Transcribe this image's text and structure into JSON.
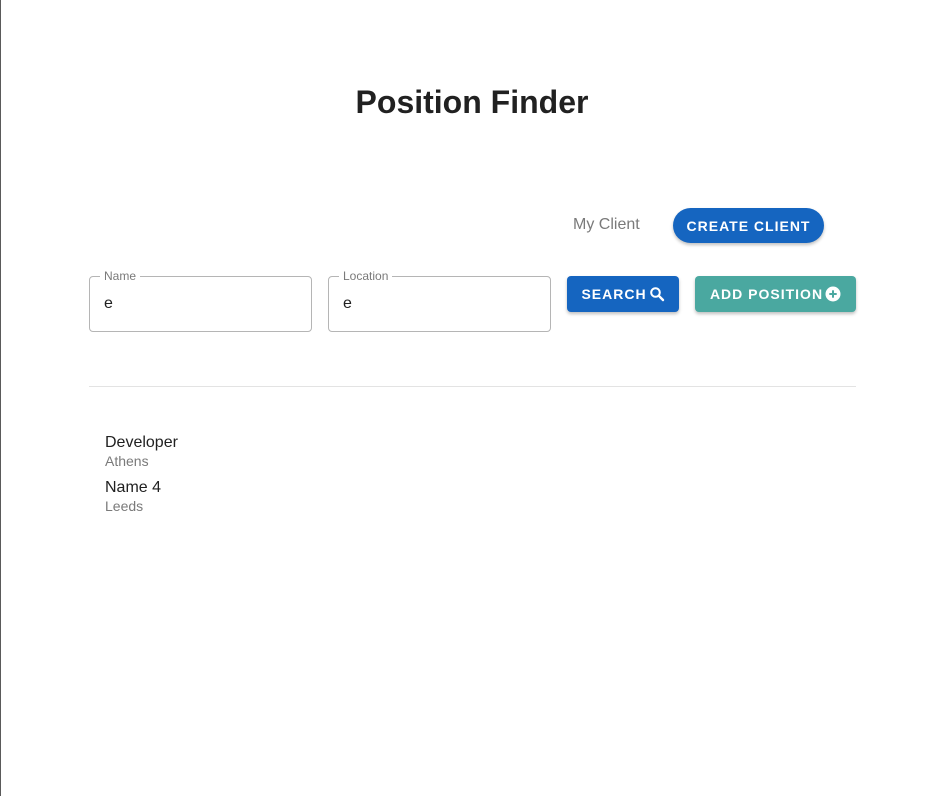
{
  "page": {
    "title": "Position Finder"
  },
  "nav": {
    "my_client_label": "My Client",
    "create_client_label": "CREATE CLIENT"
  },
  "search": {
    "name_label": "Name",
    "name_value": "e",
    "location_label": "Location",
    "location_value": "e",
    "search_label": "SEARCH",
    "search_icon": "search-icon",
    "add_position_label": "ADD POSITION",
    "add_icon": "add-circle-icon"
  },
  "results": [
    {
      "title": "Developer",
      "location": "Athens"
    },
    {
      "title": "Name 4",
      "location": "Leeds"
    }
  ],
  "colors": {
    "primary": "#1565c0",
    "accent": "#4aa8a0",
    "text": "#212121",
    "muted": "#7a7a7a"
  }
}
